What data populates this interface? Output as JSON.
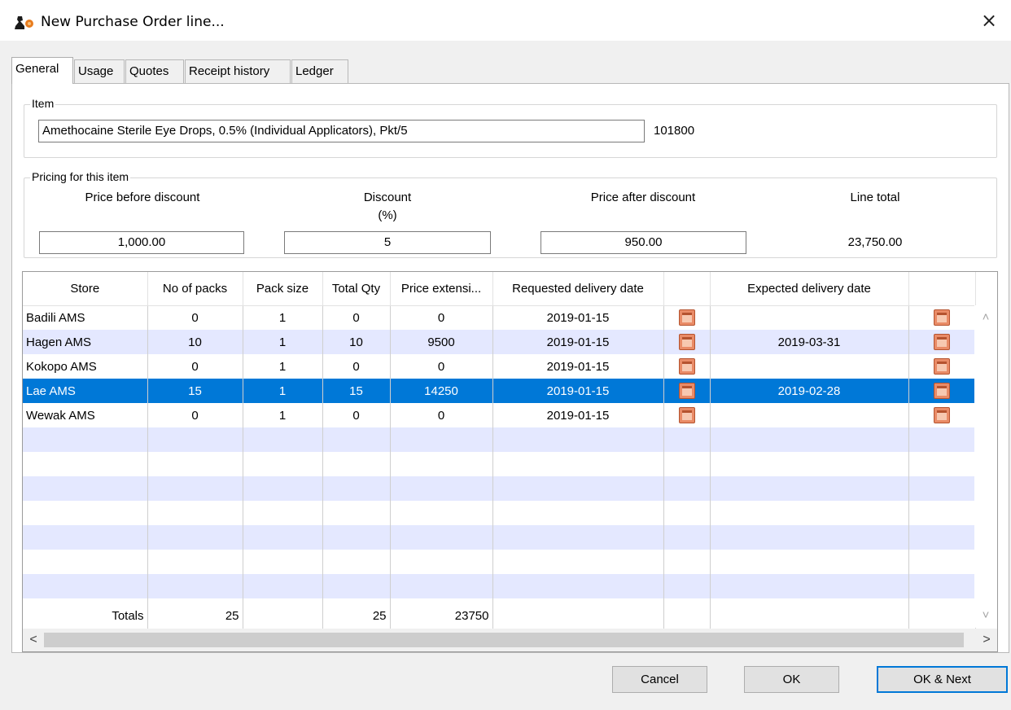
{
  "window": {
    "title": "New Purchase Order line...",
    "close_glyph": "×",
    "icon": "mSupply-logo-icon"
  },
  "tabs": [
    {
      "label": "General",
      "active": true
    },
    {
      "label": "Usage",
      "active": false
    },
    {
      "label": "Quotes",
      "active": false
    },
    {
      "label": "Receipt history",
      "active": false
    },
    {
      "label": "Ledger",
      "active": false
    }
  ],
  "item": {
    "legend": "Item",
    "name": "Amethocaine Sterile Eye Drops, 0.5% (Individual Applicators), Pkt/5",
    "code": "101800"
  },
  "pricing": {
    "legend": "Pricing for this item",
    "price_before_label": "Price before discount",
    "price_before_value": "1,000.00",
    "discount_label_line1": "Discount",
    "discount_label_line2": "(%)",
    "discount_value": "5",
    "price_after_label": "Price after discount",
    "price_after_value": "950.00",
    "line_total_label": "Line total",
    "line_total_value": "23,750.00"
  },
  "table": {
    "columns": [
      "Store",
      "No of packs",
      "Pack size",
      "Total Qty",
      "Price extensi...",
      "Requested delivery date",
      "",
      "Expected delivery date",
      ""
    ],
    "rows": [
      {
        "store": "Badili AMS",
        "packs": "0",
        "pack_size": "1",
        "total_qty": "0",
        "price_ext": "0",
        "requested": "2019-01-15",
        "expected": "",
        "selected": false
      },
      {
        "store": "Hagen AMS",
        "packs": "10",
        "pack_size": "1",
        "total_qty": "10",
        "price_ext": "9500",
        "requested": "2019-01-15",
        "expected": "2019-03-31",
        "selected": false
      },
      {
        "store": "Kokopo AMS",
        "packs": "0",
        "pack_size": "1",
        "total_qty": "0",
        "price_ext": "0",
        "requested": "2019-01-15",
        "expected": "",
        "selected": false
      },
      {
        "store": "Lae AMS",
        "packs": "15",
        "pack_size": "1",
        "total_qty": "15",
        "price_ext": "14250",
        "requested": "2019-01-15",
        "expected": "2019-02-28",
        "selected": true
      },
      {
        "store": "Wewak AMS",
        "packs": "0",
        "pack_size": "1",
        "total_qty": "0",
        "price_ext": "0",
        "requested": "2019-01-15",
        "expected": "",
        "selected": false
      }
    ],
    "totals": {
      "label": "Totals",
      "packs": "25",
      "total_qty": "25",
      "price_ext": "23750"
    },
    "calendar_icon": "calendar-icon",
    "selected_color": "#0078d7",
    "alt_row_color": "#e4e8ff"
  },
  "scroll": {
    "up": "˄",
    "down": "˅",
    "left": "<",
    "right": ">"
  },
  "buttons": {
    "cancel": "Cancel",
    "ok": "OK",
    "ok_next": "OK & Next"
  }
}
